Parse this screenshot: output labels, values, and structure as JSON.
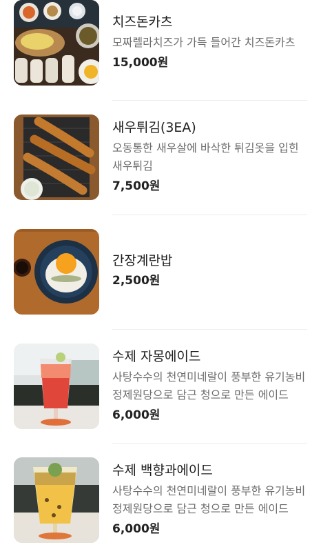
{
  "menu": {
    "items": [
      {
        "name": "치즈돈카츠",
        "description": "모짜렐라치즈가 가득 들어간 치즈돈카츠",
        "price": "15,000",
        "currency": "원",
        "image": "cheese-donkatsu-photo"
      },
      {
        "name": "새우튀김(3EA)",
        "description": "오동통한 새우살에 바삭한 튀김옷을 입힌 새우튀김",
        "price": "7,500",
        "currency": "원",
        "image": "fried-shrimp-photo"
      },
      {
        "name": "간장계란밥",
        "description": "",
        "price": "2,500",
        "currency": "원",
        "image": "soy-egg-rice-photo"
      },
      {
        "name": "수제 자몽에이드",
        "description": "사탕수수의 천연미네랄이 풍부한 유기농비정제원당으로 담근 청으로 만든 에이드",
        "price": "6,000",
        "currency": "원",
        "image": "grapefruit-ade-photo"
      },
      {
        "name": "수제 백향과에이드",
        "description": "사탕수수의 천연미네랄이 풍부한 유기농비정제원당으로 담근 청으로 만든 에이드",
        "price": "6,000",
        "currency": "원",
        "image": "passionfruit-ade-photo"
      }
    ]
  }
}
